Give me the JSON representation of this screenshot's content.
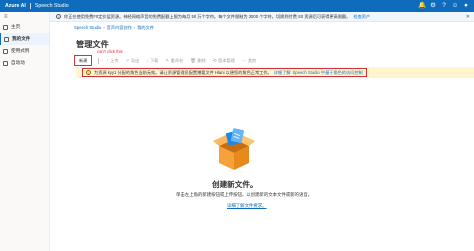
{
  "topbar": {
    "brand": "Azure AI",
    "app": "Speech Studio"
  },
  "sidebar": {
    "items": [
      {
        "label": "主页"
      },
      {
        "label": "我的文件"
      },
      {
        "label": "使用式例"
      },
      {
        "label": "自动动"
      }
    ]
  },
  "banner": {
    "text": "你正在使用免费F0定价层资源。神经网络声音的免费配额上限为每月 50 万个字符。每个文件限制为 3000 个字符。切换到付费 S0 资源后可获得更高限额。",
    "link": "检查资产"
  },
  "breadcrumb": [
    "Speech Studio",
    "音声内容创作",
    "我的文件"
  ],
  "page": {
    "title": "管理文件",
    "annotation": "can't click this"
  },
  "toolbar": {
    "new_label": "新建",
    "items": [
      "上传",
      "导出",
      "下载",
      "重命名",
      "删除",
      "版本管理",
      "其他"
    ]
  },
  "warning": {
    "text": "为资源 kyy1 分配的角色当前无效。请让资源管理员配置赠要文件 Hlani 以便您的角色正常工作。",
    "link_prefix": "详细了解",
    "link": "Speech Studio 中基于角色的访问控制"
  },
  "empty_state": {
    "title": "创建新文件。",
    "description": "单击左上角的新建按钮或上传按钮，以创建新的文本文件或新的语音。",
    "link": "详细了解文件要求。"
  }
}
